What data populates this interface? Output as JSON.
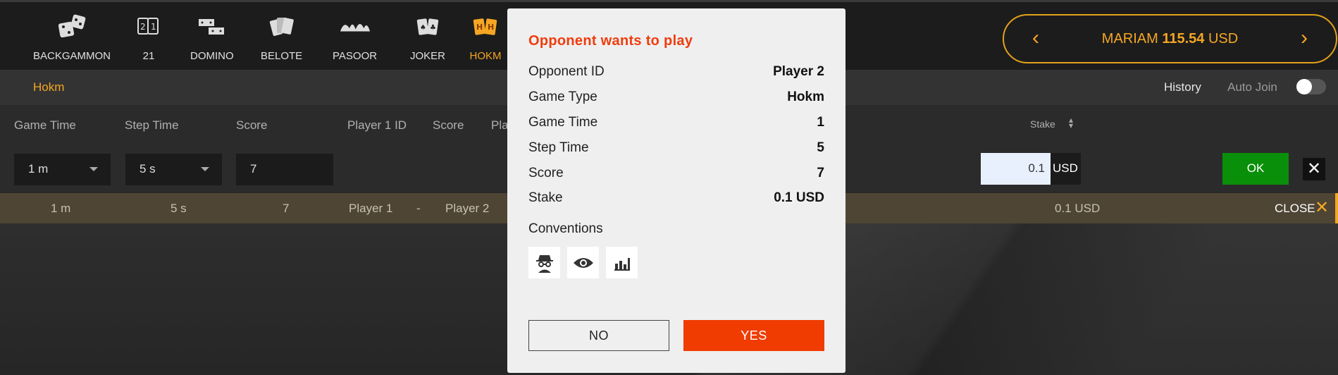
{
  "games": [
    {
      "label": "BACKGAMMON",
      "icon": "dice-icon",
      "active": false
    },
    {
      "label": "21",
      "icon": "cards-21-icon",
      "active": false
    },
    {
      "label": "DOMINO",
      "icon": "domino-icon",
      "active": false
    },
    {
      "label": "BELOTE",
      "icon": "belote-cards-icon",
      "active": false
    },
    {
      "label": "PASOOR",
      "icon": "pasoor-suits-icon",
      "active": false
    },
    {
      "label": "JOKER",
      "icon": "joker-cards-icon",
      "active": false
    },
    {
      "label": "HOKM",
      "icon": "hokm-cards-icon",
      "active": true
    }
  ],
  "account": {
    "name": "MARIAM",
    "balance": "115.54",
    "currency": "USD"
  },
  "subbar": {
    "title": "Hokm",
    "history": "History",
    "auto_join": "Auto Join"
  },
  "filters": {
    "headers": [
      "Game Time",
      "Step Time",
      "Score",
      "Player 1 ID",
      "Score",
      "Pla"
    ],
    "game_time": "1 m",
    "step_time": "5 s",
    "score": "7",
    "stake_header": "Stake",
    "stake_value": "0.1",
    "stake_currency": "USD",
    "ok": "OK"
  },
  "row": {
    "game_time": "1 m",
    "step_time": "5 s",
    "score": "7",
    "player1": "Player 1",
    "sep": "-",
    "player2": "Player 2",
    "stake": "0.1 USD",
    "close": "CLOSE"
  },
  "modal": {
    "title": "Opponent wants to play",
    "fields": [
      {
        "label": "Opponent ID",
        "value": "Player 2"
      },
      {
        "label": "Game Type",
        "value": "Hokm"
      },
      {
        "label": "Game Time",
        "value": "1"
      },
      {
        "label": "Step Time",
        "value": "5"
      },
      {
        "label": "Score",
        "value": "7"
      },
      {
        "label": "Stake",
        "value": "0.1 USD"
      }
    ],
    "conventions_label": "Conventions",
    "conventions": [
      "spy-icon",
      "eye-icon",
      "stats-icon"
    ],
    "no": "NO",
    "yes": "YES"
  },
  "colors": {
    "accent": "#f5a623",
    "yes": "#f03c00",
    "ok": "#0a8f0a"
  }
}
